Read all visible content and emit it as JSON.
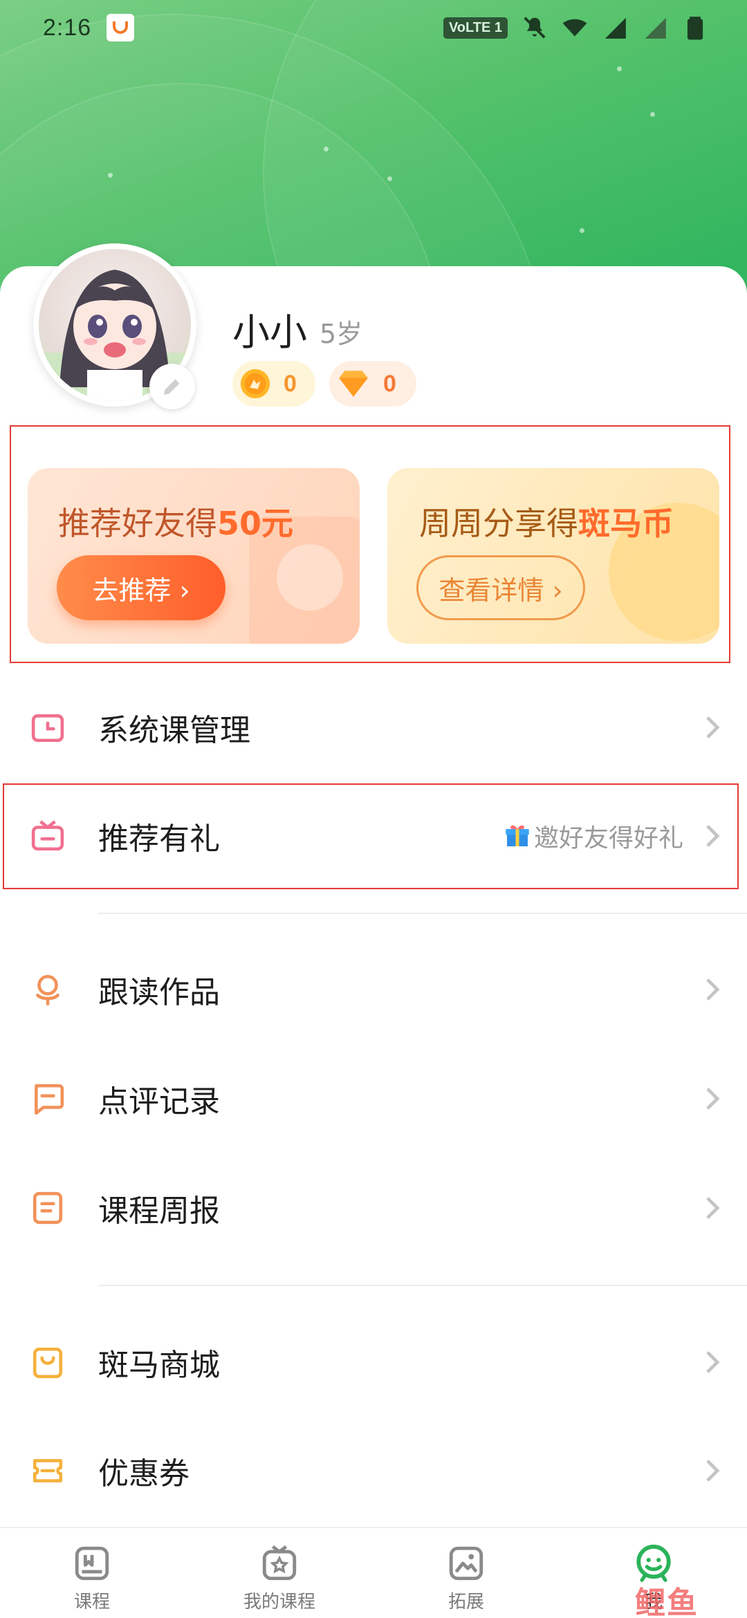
{
  "status_bar": {
    "time": "2:16",
    "network": "VoLTE 1"
  },
  "profile": {
    "name": "小小",
    "age": "5岁",
    "coins": "0",
    "gems": "0"
  },
  "promos": {
    "left": {
      "title_prefix": "推荐好友得",
      "title_highlight": "50元",
      "button": "去推荐 ›"
    },
    "right": {
      "title_prefix": "周周分享得",
      "title_highlight": "斑马币",
      "button": "查看详情 ›"
    }
  },
  "menu": {
    "system_course": "系统课管理",
    "referral": "推荐有礼",
    "referral_sub": "邀好友得好礼",
    "reading_works": "跟读作品",
    "review_records": "点评记录",
    "weekly_report": "课程周报",
    "store": "斑马商城",
    "coupons": "优惠券"
  },
  "bottom_nav": {
    "courses": "课程",
    "my_courses": "我的课程",
    "explore": "拓展",
    "me": "我"
  },
  "watermark": "鲤鱼",
  "colors": {
    "header_green": "#4cbf64",
    "accent_orange": "#ff6b2c",
    "nav_active_green": "#2bb35a",
    "annotation_red": "#e53935"
  }
}
